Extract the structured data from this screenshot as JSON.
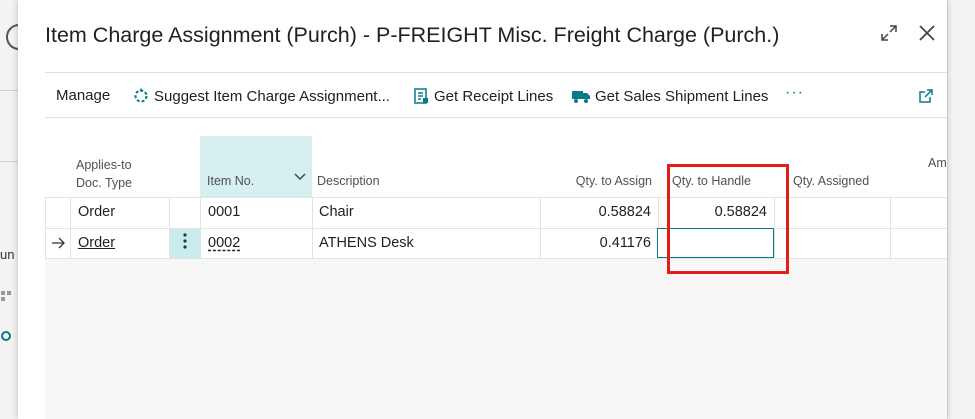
{
  "dialog": {
    "title": "Item Charge Assignment (Purch) - P-FREIGHT Misc. Freight Charge (Purch.)"
  },
  "background": {
    "partial_text": "un"
  },
  "actions": {
    "manage": "Manage",
    "suggest": "Suggest Item Charge Assignment...",
    "get_receipt": "Get Receipt Lines",
    "get_sales_shipment": "Get Sales Shipment Lines",
    "more": "···"
  },
  "grid": {
    "headers": {
      "applies_to_line1": "Applies-to",
      "applies_to_line2": "Doc. Type",
      "item_no": "Item No.",
      "description": "Description",
      "qty_to_assign": "Qty. to Assign",
      "qty_to_handle": "Qty. to Handle",
      "qty_assigned": "Qty. Assigned",
      "amount_partial": "Am"
    },
    "rows": [
      {
        "doc_type": "Order",
        "item_no": "0001",
        "description": "Chair",
        "qty_to_assign": "0.58824",
        "qty_to_handle": "0.58824",
        "qty_assigned": ""
      },
      {
        "doc_type": "Order",
        "item_no": "0002",
        "description": "ATHENS Desk",
        "qty_to_assign": "0.41176",
        "qty_to_handle": "",
        "qty_assigned": ""
      }
    ]
  },
  "colors": {
    "accent": "#087a8c",
    "selected_header": "#d6f0f2",
    "highlight": "#e31c1c"
  }
}
